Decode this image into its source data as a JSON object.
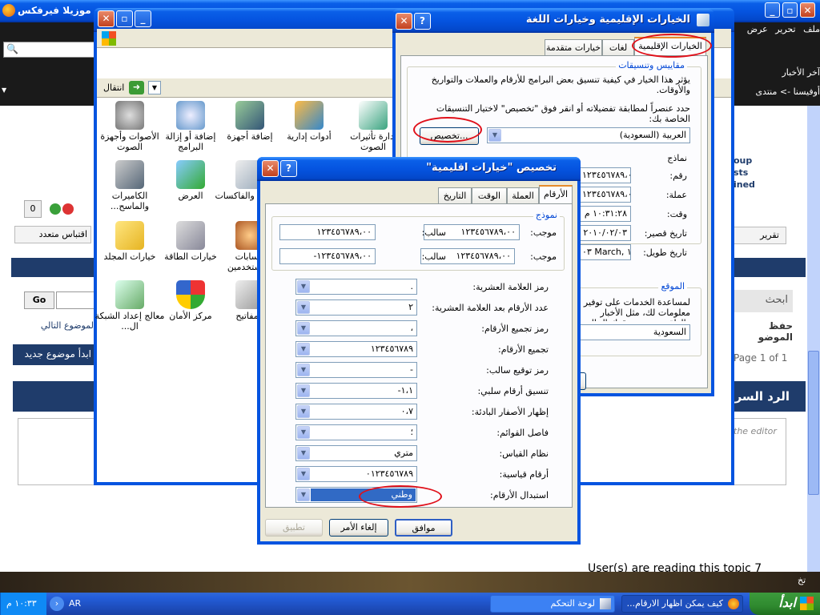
{
  "firefox": {
    "title": "موزيلا فيرفكس",
    "menu": [
      "ملف",
      "تحرير",
      "عرض"
    ],
    "bookmark1": "آخر الأخبار",
    "bookmark2": "أوفيسنا -> منتدى",
    "post_count": "0",
    "quote_btn": "اقتباس متعدد",
    "report_btn": "تقرير",
    "go": "Go",
    "next_topic": "الموضوع التالي",
    "new_topic": "ابدأ موضوع جديد",
    "search_side": "ابحث",
    "save_side": "حفظ الموضو",
    "page_info": "Page 1 of 1",
    "quick_reply": "الرد السر",
    "editor_hint": "the editor",
    "readers": "User(s) are reading this topic 7",
    "group_info": [
      "oup",
      "sts",
      "ined"
    ]
  },
  "control_panel": {
    "back": "انتقال",
    "items": [
      {
        "label": "إدارة تأثيرات الصوت",
        "icon": "sound-effects-icon"
      },
      {
        "label": "أدوات إدارية",
        "icon": "admin-tools-icon"
      },
      {
        "label": "إضافة أجهزة",
        "icon": "add-hardware-icon"
      },
      {
        "label": "إضافة أو إزالة البرامج",
        "icon": "add-remove-programs-icon"
      },
      {
        "label": "الأصوات وأجهزة الصوت",
        "icon": "sounds-icon"
      },
      {
        "label": "طابعات والفاكسات",
        "icon": "printers-icon"
      },
      {
        "label": "العرض",
        "icon": "display-icon"
      },
      {
        "label": "الكاميرات والماسح...",
        "icon": "scanners-icon"
      },
      {
        "label": "حسابات المستخدمين",
        "icon": "user-accounts-icon"
      },
      {
        "label": "خيارات الطاقة",
        "icon": "power-options-icon"
      },
      {
        "label": "خيارات المجلد",
        "icon": "folder-options-icon"
      },
      {
        "label": "المفاتيح",
        "icon": "keyboard-icon"
      },
      {
        "label": "مركز الأمان",
        "icon": "security-center-icon"
      },
      {
        "label": "معالج إعداد الشبكة ال...",
        "icon": "network-wizard-icon"
      }
    ]
  },
  "regional": {
    "title": "الخيارات الإقليمية وخيارات اللغة",
    "tabs": [
      "الخيارات الإقليمية",
      "لغات",
      "خيارات متقدمة"
    ],
    "group1": "مقاييس وتنسيقات",
    "desc1": "يؤثر هذا الخيار في كيفية تنسيق بعض البرامج للأرقام والعملات والتواريخ والأوقات.",
    "desc2": "حدد عنصراً لمطابقة تفضيلاته أو انقر فوق \"تخصيص\" لاختيار التنسيقات الخاصة بك:",
    "locale": "العربية (السعودية)",
    "customize": "تخصيص...",
    "samples": "نماذج",
    "rows": [
      {
        "label": "رقم:",
        "value": "١٢٣٤٥٦٧٨٩،٠٠"
      },
      {
        "label": "عملة:",
        "value": "ر.س. ١٢٣٤٥٦٧٨٩،٠٠"
      },
      {
        "label": "وقت:",
        "value": "١٠:٣١:٢٨ م"
      },
      {
        "label": "تاريخ قصير:",
        "value": "٢٠١٠/٠٢/٠٣"
      },
      {
        "label": "تاريخ طويل:",
        "value": "٠٣ March, ١٠"
      }
    ],
    "location_group": "الموقع",
    "location_desc": "لمساعدة الخدمات على توفير معلومات لك، مثل الأخبار والطقس، حدد موقعك الحالي:",
    "location": "السعودية"
  },
  "custom": {
    "title": "تخصيص \"خيارات اقليمية\"",
    "tabs": [
      "الأرقام",
      "العملة",
      "الوقت",
      "التاريخ"
    ],
    "sample_group": "نموذج",
    "positive": "موجب:",
    "negative": "سالب:",
    "pos1": "١٢٣٤٥٦٧٨٩،٠٠",
    "neg1": "١٢٣٤٥٦٧٨٩،٠٠",
    "pos2": "١٢٣٤٥٦٧٨٩،٠٠",
    "neg2": "-١٢٣٤٥٦٧٨٩،٠٠",
    "settings": [
      {
        "label": "رمز العلامة العشرية:",
        "value": "."
      },
      {
        "label": "عدد الأرقام بعد العلامة العشرية:",
        "value": "٢"
      },
      {
        "label": "رمز تجميع الأرقام:",
        "value": "،"
      },
      {
        "label": "تجميع الأرقام:",
        "value": "١٢٣٤٥٦٧٨٩"
      },
      {
        "label": "رمز توقيع سالب:",
        "value": "-"
      },
      {
        "label": "تنسيق أرقام سلبي:",
        "value": "-١،١"
      },
      {
        "label": "إظهار الأصفار البادئة:",
        "value": "٠،٧"
      },
      {
        "label": "فاصل القوائم:",
        "value": "؛"
      },
      {
        "label": "نظام القياس:",
        "value": "متري"
      },
      {
        "label": "أرقام قياسية:",
        "value": "٠١٢٣٤٥٦٧٨٩"
      },
      {
        "label": "استبدال الأرقام:",
        "value": "وطني"
      }
    ],
    "ok": "موافق",
    "cancel": "إلغاء الأمر",
    "apply": "تطبيق"
  },
  "taskbar": {
    "start": "ابدأ",
    "task1": "كيف يمكن اظهار الارقام...",
    "task2": "لوحة التحكم",
    "lang": "AR",
    "clock": "١٠:٣٣ م",
    "tray": "تخ"
  },
  "colors": {
    "xp_blue": "#0554e0",
    "forum_header": "#1f3c6b",
    "dialog_bg": "#ece9d8",
    "highlight": "#316ac5"
  }
}
